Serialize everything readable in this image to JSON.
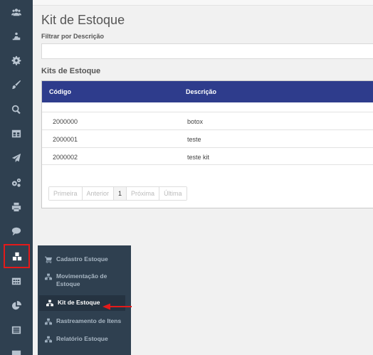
{
  "page": {
    "title": "Kit de Estoque",
    "filter_label": "Filtrar por Descrição",
    "filter_value": "",
    "section_title": "Kits de Estoque"
  },
  "table": {
    "headers": {
      "code": "Código",
      "description": "Descrição"
    },
    "rows": [
      {
        "code": "2000000",
        "description": "botox"
      },
      {
        "code": "2000001",
        "description": "teste"
      },
      {
        "code": "2000002",
        "description": "teste kit"
      }
    ]
  },
  "pagination": {
    "first": "Primeira",
    "previous": "Anterior",
    "current": "1",
    "next": "Próxima",
    "last": "Última"
  },
  "submenu": {
    "items": [
      {
        "label": "Cadastro Estoque",
        "icon": "cart-icon"
      },
      {
        "label": "Movimentação de Estoque",
        "icon": "sitemap-icon"
      },
      {
        "label": "Kit de Estoque",
        "icon": "sitemap-icon"
      },
      {
        "label": "Rastreamento de Itens",
        "icon": "sitemap-icon"
      },
      {
        "label": "Relatório Estoque",
        "icon": "sitemap-icon"
      }
    ],
    "active": "Kit de Estoque"
  },
  "sidebar": {
    "icons": [
      "users-icon",
      "hand-icon",
      "gear-icon",
      "brush-icon",
      "search-icon",
      "table-icon",
      "paper-plane-icon",
      "cogs-icon",
      "print-icon",
      "comment-icon",
      "cubes-icon",
      "calendar-grid-icon",
      "pie-chart-icon",
      "list-icon",
      "report-icon"
    ],
    "active": "cubes-icon"
  },
  "colors": {
    "sidebar_bg": "#2f4050",
    "table_header_bg": "#2e3c8c",
    "highlight_red": "#e41a1a"
  }
}
